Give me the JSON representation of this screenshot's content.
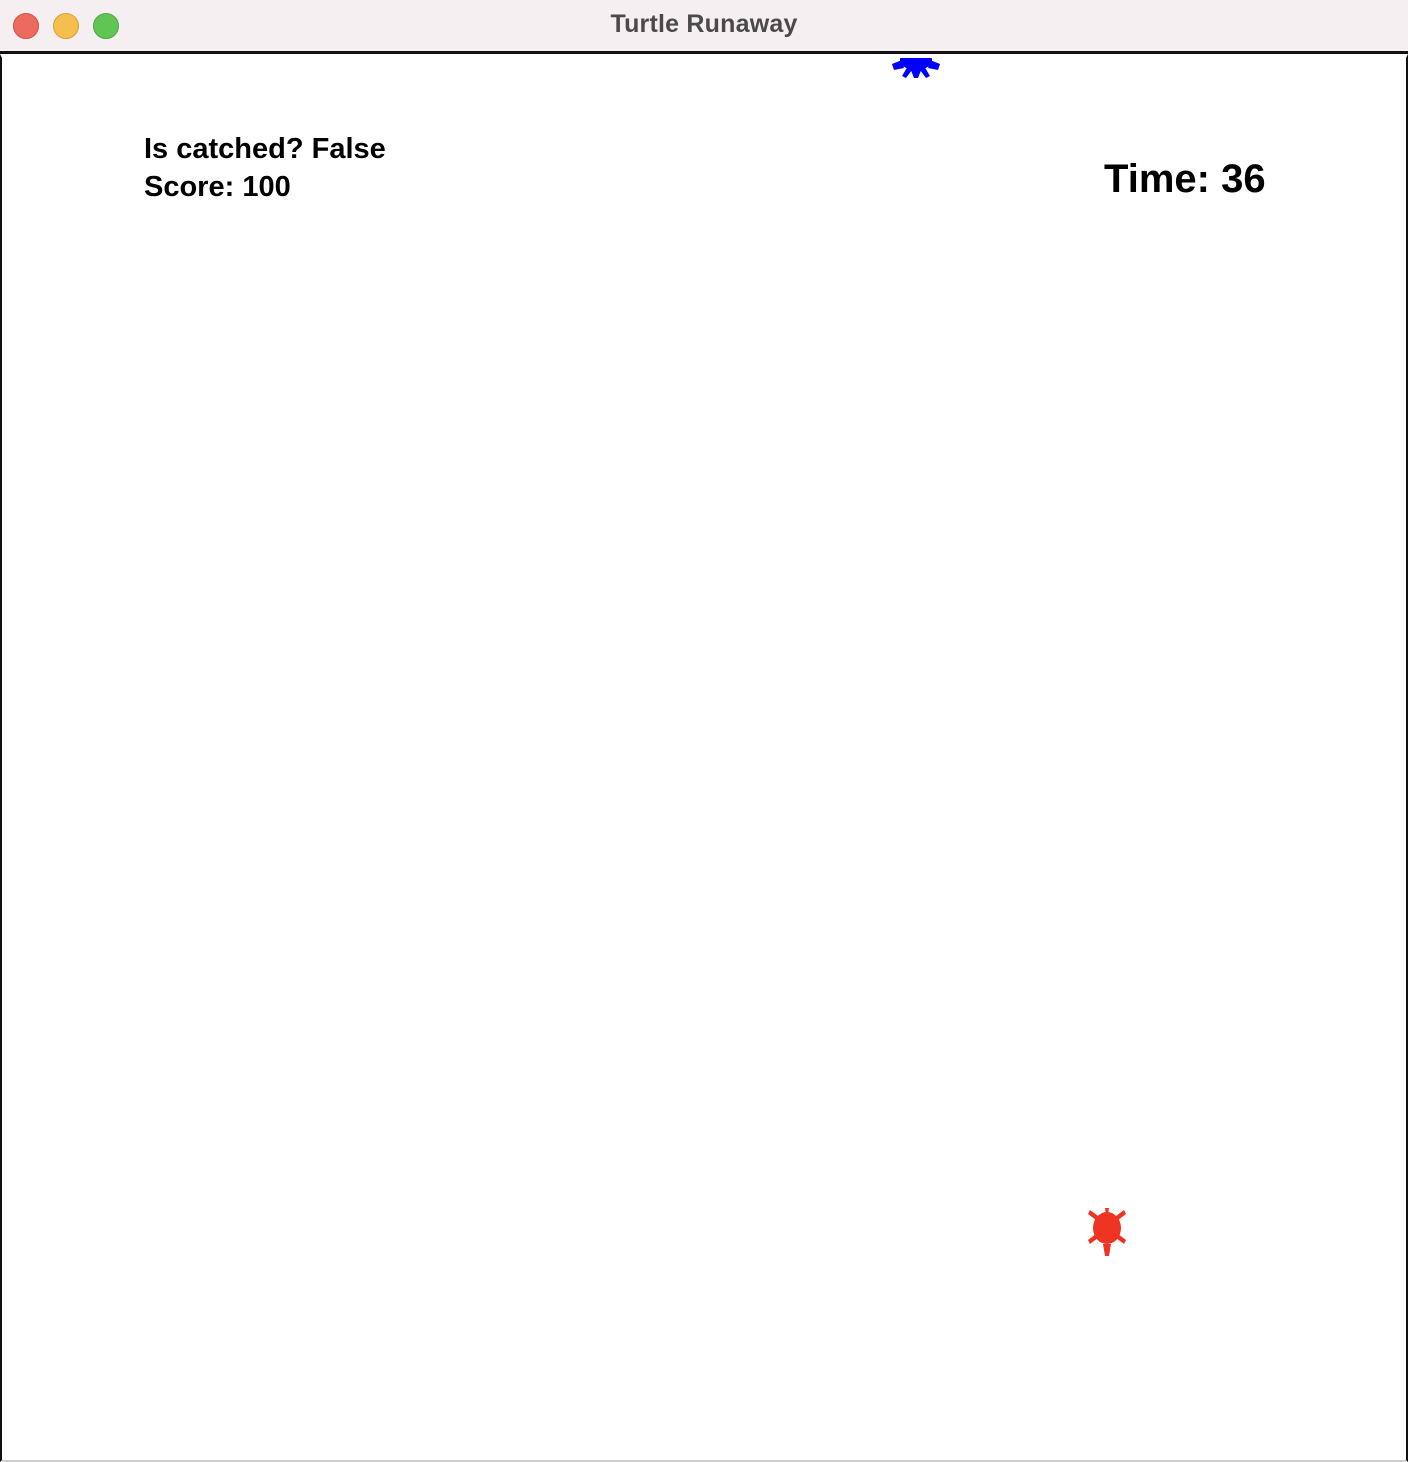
{
  "window": {
    "title": "Turtle Runaway"
  },
  "hud": {
    "caught_label": "Is catched?",
    "caught_value": "False",
    "score_label": "Score:",
    "score_value": "100",
    "time_label": "Time:",
    "time_value": "36"
  },
  "sprites": {
    "chaser": {
      "color": "#0000ff",
      "icon": "turtle-icon"
    },
    "runner": {
      "color": "#ee3322",
      "icon": "turtle-icon"
    }
  },
  "colors": {
    "traffic_close": "#ed6a5e",
    "traffic_minimize": "#f5bf4f",
    "traffic_zoom": "#61c554"
  }
}
